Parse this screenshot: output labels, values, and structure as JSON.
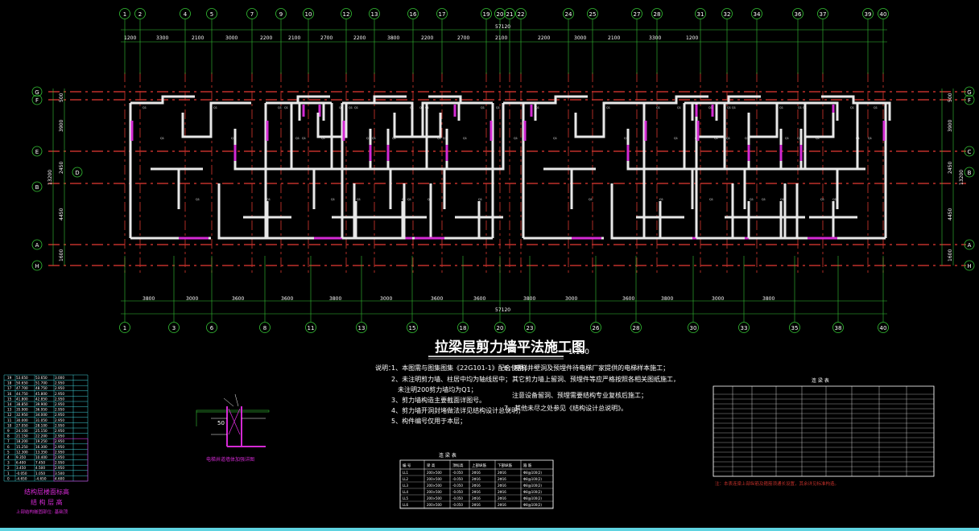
{
  "drawing": {
    "title": "拉梁层剪力墙平法施工图",
    "scale": "1:100"
  },
  "colors": {
    "background": "#000000",
    "axis_red": "#c0302a",
    "dim_green": "#35c435",
    "wall_white": "#e8e8e8",
    "wall_magenta": "#d42ad4",
    "text_white": "#ffffff",
    "table_red": "#c0302a",
    "table_cyan": "#3fd0d8",
    "status_cyan": "#5fd3e0"
  },
  "axes": {
    "top_labels": [
      "1",
      "2",
      "4",
      "5",
      "7",
      "9",
      "10",
      "12",
      "13",
      "16",
      "17",
      "19",
      "20",
      "21",
      "22",
      "24",
      "25",
      "27",
      "28",
      "31",
      "32",
      "34",
      "36",
      "37",
      "39",
      "40"
    ],
    "bottom_labels": [
      "1",
      "3",
      "6",
      "8",
      "11",
      "13",
      "15",
      "18",
      "20",
      "23",
      "26",
      "28",
      "30",
      "33",
      "35",
      "38",
      "40"
    ],
    "row_labels_left": [
      "G",
      "F",
      "E",
      "D",
      "B",
      "A",
      "H"
    ],
    "row_labels_right": [
      "G",
      "F",
      "C",
      "B",
      "A",
      "H"
    ]
  },
  "dimensions": {
    "top_total": "57120",
    "top_segments": [
      "1200",
      "3300",
      "2100",
      "3000",
      "2200",
      "2100",
      "2700",
      "2200",
      "3800",
      "2200",
      "2700",
      "2100",
      "2200",
      "3000",
      "2100",
      "3300",
      "1200"
    ],
    "bottom_total": "57120",
    "bottom_segments": [
      "3800",
      "3000",
      "3600",
      "3600",
      "3800",
      "3000",
      "3600",
      "3600",
      "3800",
      "3000",
      "3600",
      "3800",
      "3000",
      "3800"
    ],
    "left_segments": [
      "500",
      "3900",
      "2450",
      "4450",
      "1600"
    ],
    "left_total": "13200",
    "right_segments": [
      "500",
      "3900",
      "2450",
      "4450",
      "1600"
    ],
    "right_total": "13200"
  },
  "notes": {
    "heading": "说明：",
    "items": [
      "1、本图需与图集图集《22G101-1》配合使用；",
      "2、未注明剪力墙、柱居中均为轴线居中；",
      "未注明200剪力墙均为Q1；",
      "3、剪力墙构造主要截面详图号。",
      "4、剪力墙开洞封堵做法详见结构设计总说明；",
      "5、构件编号仅用于本层；",
      "6、电梯井壁洞及预埋件待电梯厂家提供的电梯样本施工；",
      "其它剪力墙上留洞、预埋件等应严格按照各相关图纸施工，",
      "注意设备留洞、预埋需要结构专业复核后施工；",
      "7、其他未尽之处参见《结构设计总说明》。"
    ]
  },
  "left_table": {
    "rows": [
      [
        "53.650",
        "53.650",
        "3.000"
      ],
      [
        "50.650",
        "51.700",
        "2.950"
      ],
      [
        "47.700",
        "48.750",
        "2.950"
      ],
      [
        "44.750",
        "45.800",
        "2.950"
      ],
      [
        "41.800",
        "42.850",
        "2.950"
      ],
      [
        "38.850",
        "39.900",
        "2.950"
      ],
      [
        "35.900",
        "36.950",
        "2.950"
      ],
      [
        "32.950",
        "34.000",
        "2.950"
      ],
      [
        "30.000",
        "31.050",
        "2.950"
      ],
      [
        "27.050",
        "28.100",
        "2.950"
      ],
      [
        "24.100",
        "25.150",
        "2.950"
      ],
      [
        "21.150",
        "22.200",
        "2.950"
      ],
      [
        "18.200",
        "19.250",
        "2.950"
      ],
      [
        "15.250",
        "16.300",
        "2.950"
      ],
      [
        "12.300",
        "13.350",
        "2.950"
      ],
      [
        "9.350",
        "10.400",
        "2.950"
      ],
      [
        "6.400",
        "7.450",
        "2.950"
      ],
      [
        "3.450",
        "4.500",
        "2.950"
      ],
      [
        "-0.050",
        "1.050",
        "3.500"
      ],
      [
        "-4.650",
        "-4.650",
        "4.600"
      ]
    ],
    "footer_1": "结构层楼面标高",
    "footer_2": "结 构 层 高",
    "footer_3": "上部结构嵌固部位: 基础顶"
  },
  "detail": {
    "label": "50",
    "caption": "电梯井道墙体加强详图"
  },
  "table_mid": {
    "title": "连 梁 表",
    "headers": [
      "编 号",
      "梁 高",
      "顶标高",
      "上部纵筋",
      "下部纵筋",
      "箍 筋"
    ],
    "rows": [
      [
        "LL1",
        "200×500",
        "-0.050",
        "2Φ16",
        "2Φ16",
        "Φ8@100(2)"
      ],
      [
        "LL2",
        "200×500",
        "-0.050",
        "2Φ16",
        "2Φ16",
        "Φ8@100(2)"
      ],
      [
        "LL3",
        "200×500",
        "-0.050",
        "2Φ16",
        "2Φ16",
        "Φ8@100(2)"
      ],
      [
        "LL4",
        "200×500",
        "-0.050",
        "2Φ16",
        "2Φ16",
        "Φ8@100(2)"
      ],
      [
        "LL5",
        "200×500",
        "-0.050",
        "2Φ16",
        "2Φ16",
        "Φ8@100(2)"
      ],
      [
        "LL6",
        "200×500",
        "-0.050",
        "2Φ16",
        "2Φ16",
        "Φ8@100(2)"
      ]
    ]
  },
  "table_right": {
    "title": "连 梁 表",
    "header_cols": 9,
    "row_count": 17,
    "footnote": "注：本表连梁上部纵筋及箍筋须通长设置，其余详见标准构造。"
  }
}
